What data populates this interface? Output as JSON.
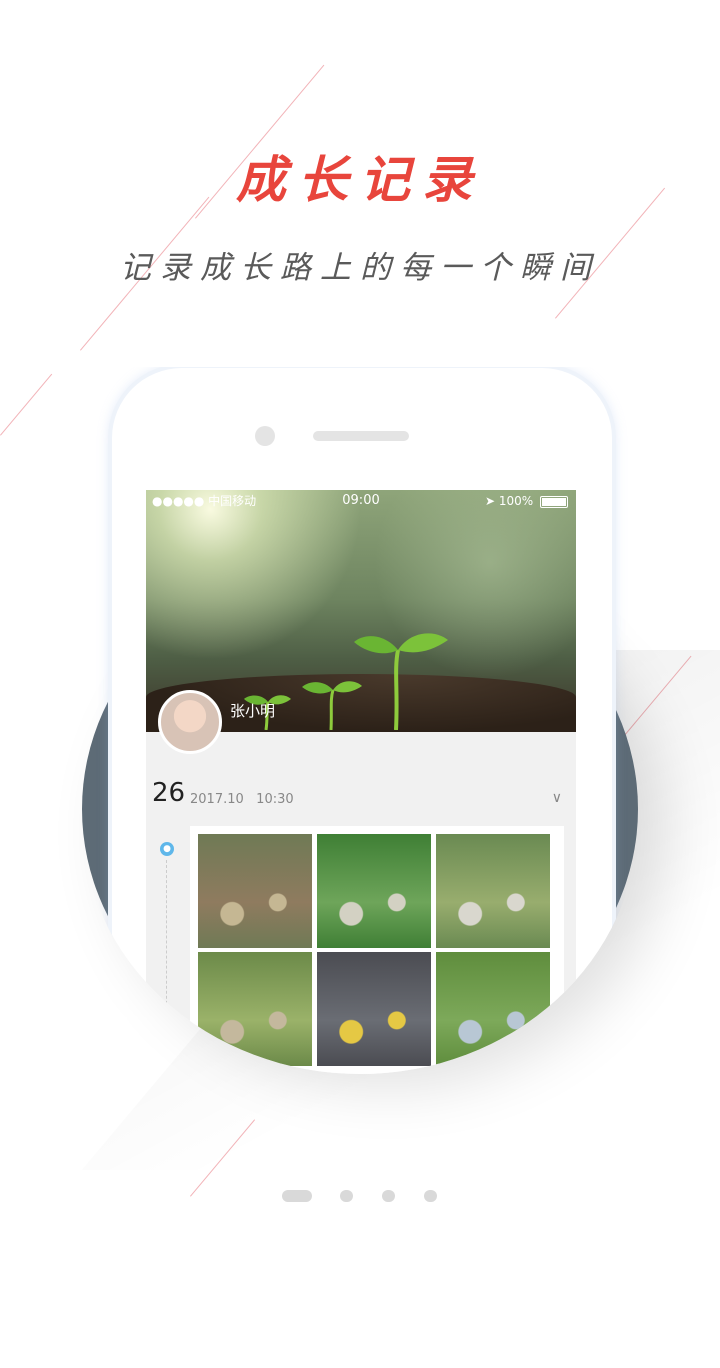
{
  "header": {
    "title": "成长记录",
    "subtitle": "记录成长路上的每一个瞬间"
  },
  "status_bar": {
    "carrier": "●●●●● 中国移动",
    "time": "09:00",
    "battery": "100%"
  },
  "profile": {
    "name": "张小明"
  },
  "entry": {
    "day": "26",
    "date": "2017.10",
    "time": "10:30"
  },
  "photos": [
    {
      "colors": [
        "#6f7a55",
        "#8f7b5f",
        "#c5b793"
      ]
    },
    {
      "colors": [
        "#3f7f35",
        "#6ea55a",
        "#d3d1c3"
      ]
    },
    {
      "colors": [
        "#6a8a52",
        "#98ad6e",
        "#d9d7ce"
      ]
    },
    {
      "colors": [
        "#6c8a49",
        "#9ab269",
        "#c4b89d"
      ]
    },
    {
      "colors": [
        "#4b4c52",
        "#6a6d74",
        "#e5c844"
      ]
    },
    {
      "colors": [
        "#5f8d3d",
        "#7da95a",
        "#b8c7d4"
      ]
    }
  ],
  "pagination": {
    "total": 4,
    "active": 1
  },
  "colors": {
    "accent": "#e8453c",
    "timeline": "#5fb7ea",
    "circle": "#5d6b76"
  }
}
